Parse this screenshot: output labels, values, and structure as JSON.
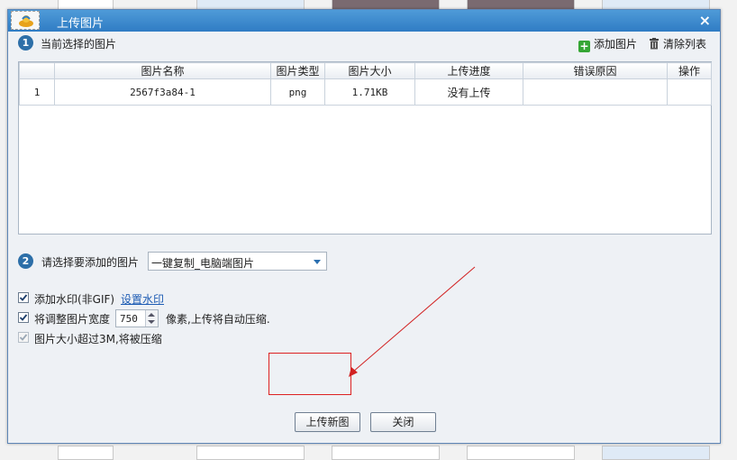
{
  "dialog": {
    "title": "上传图片",
    "close_glyph": "×"
  },
  "section1": {
    "badge": "1",
    "label": "当前选择的图片",
    "add_label": "添加图片",
    "clear_label": "清除列表"
  },
  "table": {
    "columns": [
      "",
      "图片名称",
      "图片类型",
      "图片大小",
      "上传进度",
      "错误原因",
      "操作"
    ],
    "rows": [
      [
        "1",
        "2567f3a84-1",
        "png",
        "1.71KB",
        "没有上传",
        "",
        ""
      ]
    ]
  },
  "section2": {
    "badge": "2",
    "label": "请选择要添加的图片",
    "selected": "一键复制_电脑端图片"
  },
  "options": {
    "watermark": {
      "label": "添加水印(非GIF)",
      "link": "设置水印",
      "checked": true
    },
    "resize": {
      "label": "将调整图片宽度",
      "value": "750",
      "suffix": "像素,上传将自动压缩.",
      "checked": true
    },
    "compress": {
      "label": "图片大小超过3M,将被压缩",
      "checked": true,
      "disabled": true
    }
  },
  "buttons": {
    "upload": "上传新图",
    "close": "关闭"
  },
  "colors": {
    "titlebar": "#2f7cc4",
    "badge": "#2d6fa8",
    "annotation": "#d22222",
    "link": "#1f5db4"
  }
}
